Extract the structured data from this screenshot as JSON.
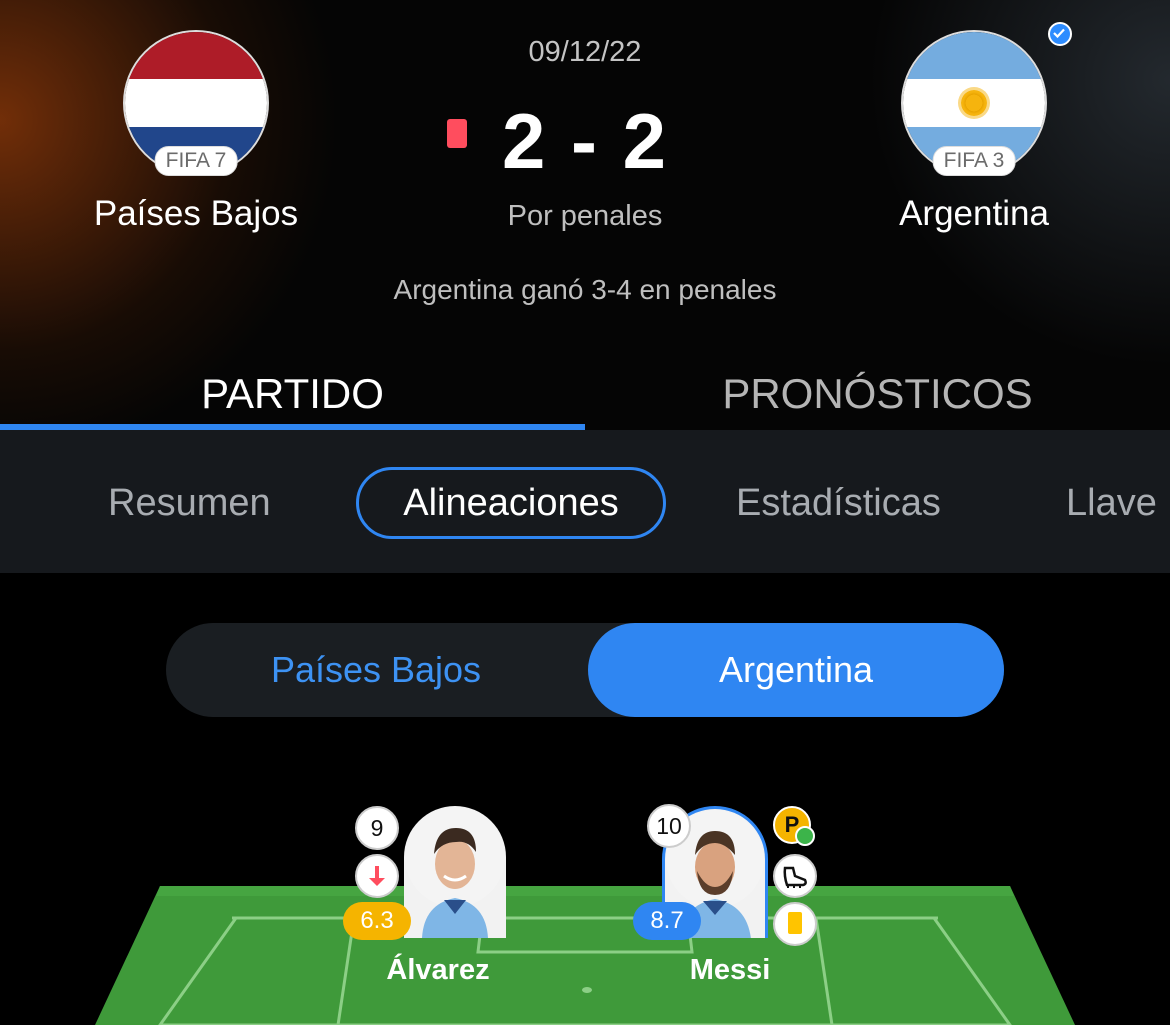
{
  "match": {
    "date": "09/12/22",
    "score": "2 - 2",
    "note": "Por penales",
    "penalty_result": "Argentina ganó 3-4 en penales",
    "home": {
      "name": "Países Bajos",
      "fifa": "FIFA 7",
      "flag": "netherlands-flag"
    },
    "away": {
      "name": "Argentina",
      "fifa": "FIFA 3",
      "flag": "argentina-flag",
      "verified": true
    }
  },
  "tabs": [
    {
      "label": "PARTIDO",
      "active": true
    },
    {
      "label": "PRONÓSTICOS",
      "active": false
    }
  ],
  "subnav": [
    {
      "label": "Resumen",
      "active": false
    },
    {
      "label": "Alineaciones",
      "active": true
    },
    {
      "label": "Estadísticas",
      "active": false
    },
    {
      "label": "Llave",
      "active": false
    }
  ],
  "team_toggle": {
    "left": "Países Bajos",
    "right": "Argentina",
    "selected": "Argentina"
  },
  "players": [
    {
      "name": "Álvarez",
      "number": "9",
      "rating": "6.3",
      "rating_color": "#f5b400",
      "icons": [
        "substituted-out-icon"
      ]
    },
    {
      "name": "Messi",
      "number": "10",
      "rating": "8.7",
      "rating_color": "#2f86f2",
      "icons": [
        "penalty-scored-icon",
        "boot-icon",
        "yellow-card-icon"
      ]
    }
  ],
  "colors": {
    "accent": "#2f86f2",
    "red_card": "#ff4d5e",
    "pitch": "#3f9a3a"
  }
}
